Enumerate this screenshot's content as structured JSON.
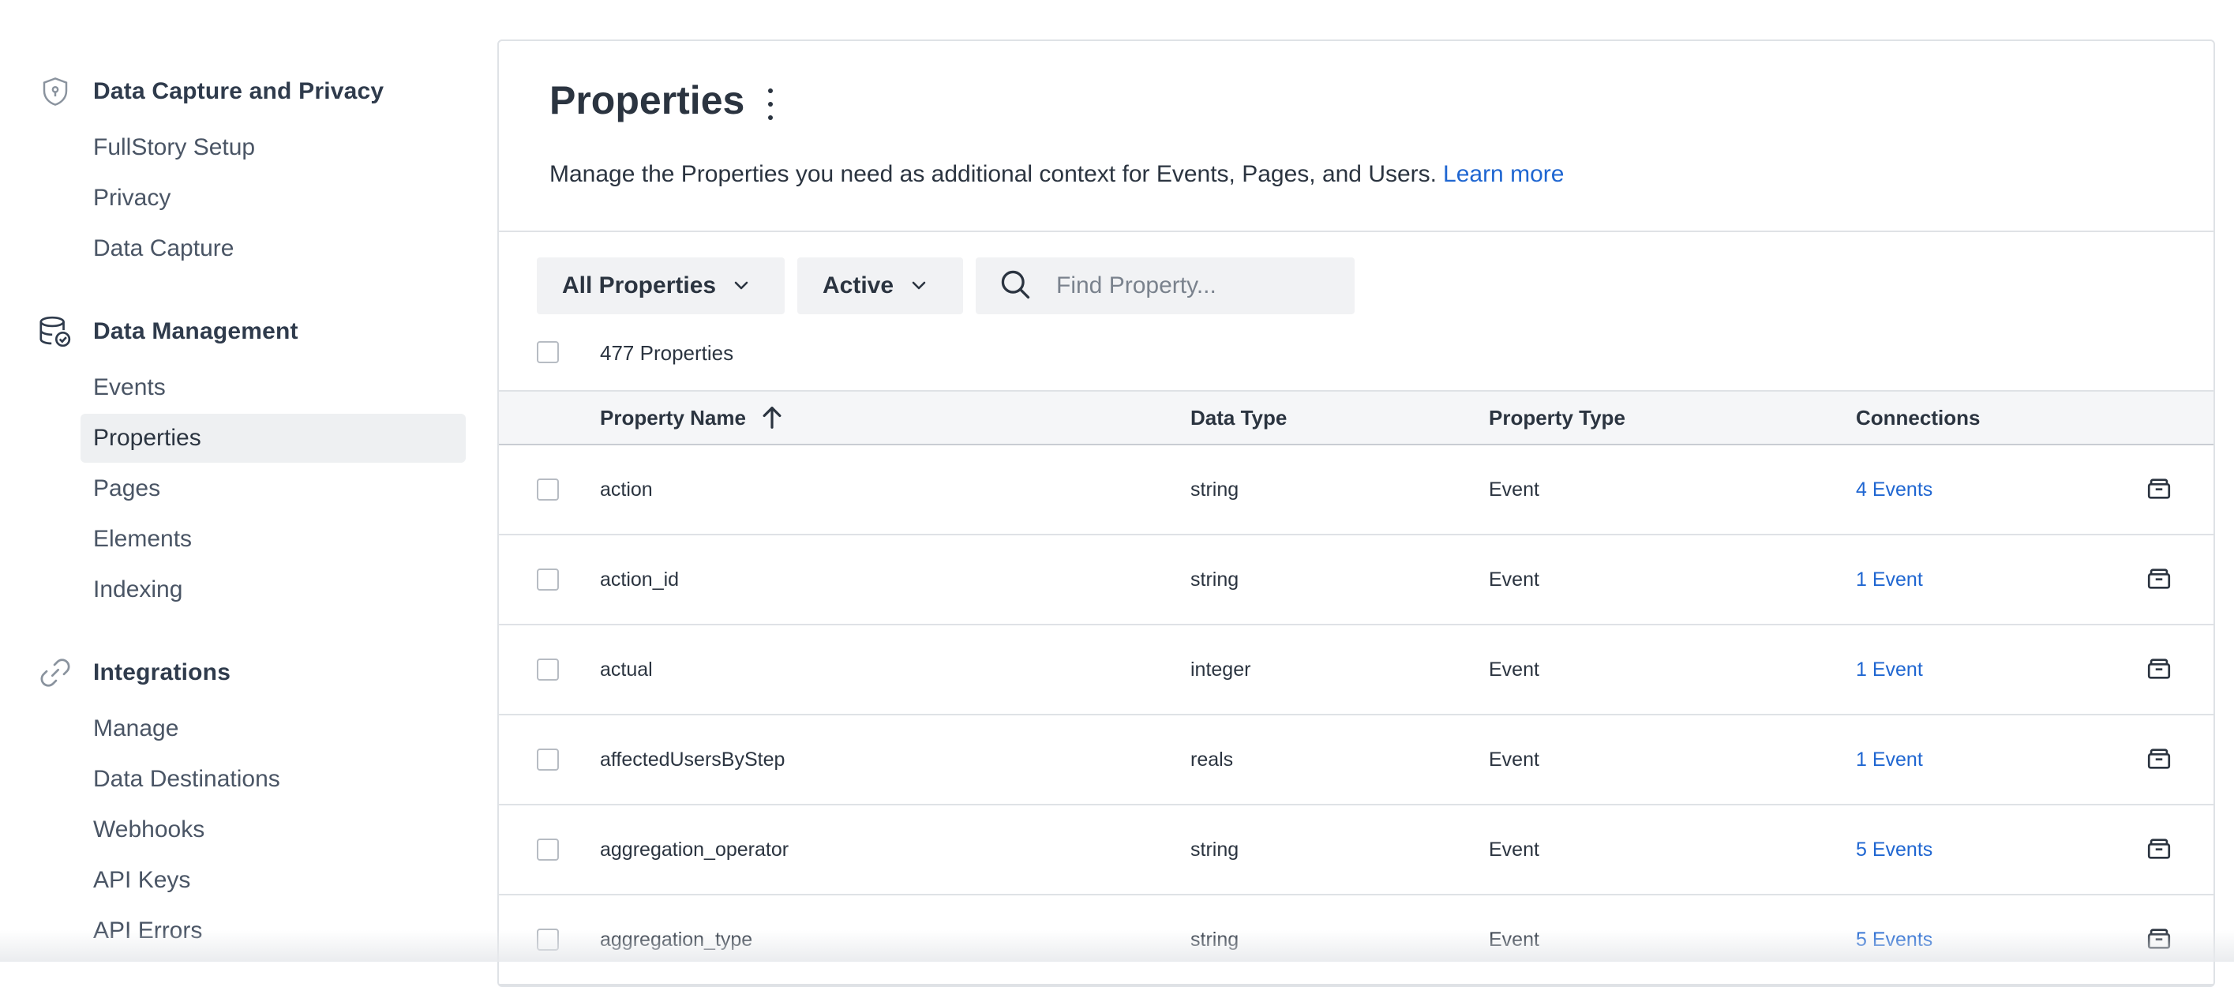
{
  "sidebar": {
    "sections": [
      {
        "title": "Data Capture and Privacy",
        "icon": "shield-icon",
        "items": [
          {
            "label": "FullStory Setup"
          },
          {
            "label": "Privacy"
          },
          {
            "label": "Data Capture"
          }
        ]
      },
      {
        "title": "Data Management",
        "icon": "database-check-icon",
        "items": [
          {
            "label": "Events"
          },
          {
            "label": "Properties",
            "active": true
          },
          {
            "label": "Pages"
          },
          {
            "label": "Elements"
          },
          {
            "label": "Indexing"
          }
        ]
      },
      {
        "title": "Integrations",
        "icon": "link-icon",
        "items": [
          {
            "label": "Manage"
          },
          {
            "label": "Data Destinations"
          },
          {
            "label": "Webhooks"
          },
          {
            "label": "API Keys"
          },
          {
            "label": "API Errors"
          }
        ]
      }
    ]
  },
  "main": {
    "title": "Properties",
    "description": "Manage the Properties you need as additional context for Events, Pages, and Users.",
    "learn_more": "Learn more",
    "filters": {
      "scope": "All Properties",
      "status": "Active"
    },
    "search": {
      "placeholder": "Find Property..."
    },
    "count_label": "477 Properties",
    "columns": {
      "name": "Property Name",
      "data_type": "Data Type",
      "property_type": "Property Type",
      "connections": "Connections"
    },
    "rows": [
      {
        "name": "action",
        "data_type": "string",
        "property_type": "Event",
        "connections": "4 Events"
      },
      {
        "name": "action_id",
        "data_type": "string",
        "property_type": "Event",
        "connections": "1 Event"
      },
      {
        "name": "actual",
        "data_type": "integer",
        "property_type": "Event",
        "connections": "1 Event"
      },
      {
        "name": "affectedUsersByStep",
        "data_type": "reals",
        "property_type": "Event",
        "connections": "1 Event"
      },
      {
        "name": "aggregation_operator",
        "data_type": "string",
        "property_type": "Event",
        "connections": "5 Events"
      },
      {
        "name": "aggregation_type",
        "data_type": "string",
        "property_type": "Event",
        "connections": "5 Events"
      }
    ]
  },
  "colors": {
    "accent_link": "#1f66d1",
    "text": "#2b3440",
    "active_nav_bg": "#eef0f2"
  }
}
